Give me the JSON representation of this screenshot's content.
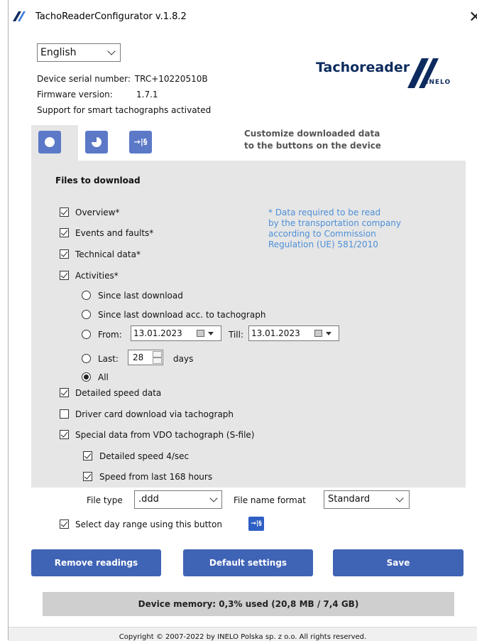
{
  "window": {
    "title": "TachoReaderConfigurator v.1.8.2",
    "close_glyph": "✕"
  },
  "language": {
    "selected": "English"
  },
  "device": {
    "serial_label": "Device serial number:",
    "serial_value": "TRC+10220510B",
    "firmware_label": "Firmware version:",
    "firmware_value": "1.7.1",
    "smart_support": "Support for smart tachographs activated"
  },
  "brand": {
    "name": "Tachoreader",
    "sub": "INELO"
  },
  "tabs": {
    "items": [
      {
        "icon": "circle-icon",
        "active": true
      },
      {
        "icon": "pie-chart-icon",
        "active": false
      },
      {
        "icon": "arrow-paragraph-icon",
        "label": "→|§",
        "active": false
      }
    ],
    "hint_line1": "Customize downloaded data",
    "hint_line2": "to the buttons on the device"
  },
  "files": {
    "title": "Files to download",
    "overview": {
      "label": "Overview*",
      "checked": true
    },
    "events": {
      "label": "Events and faults*",
      "checked": true
    },
    "technical": {
      "label": "Technical data*",
      "checked": true
    },
    "activities": {
      "label": "Activities*",
      "checked": true
    },
    "note": [
      "* Data required to be read",
      "by the transportation company",
      "according to Commission",
      "Regulation (UE) 581/2010"
    ],
    "activity_options": {
      "since_last": "Since last download",
      "since_last_tacho": "Since last download acc. to tachograph",
      "from_label": "From:",
      "from_value": "13.01.2023",
      "till_label": "Till:",
      "till_value": "13.01.2023",
      "last_label": "Last:",
      "last_value": "28",
      "days_label": "days",
      "all_label": "All",
      "selected": "all"
    },
    "detailed_speed": {
      "label": "Detailed speed data",
      "checked": true
    },
    "driver_card": {
      "label": "Driver card download via tachograph",
      "checked": false
    },
    "special_vdo": {
      "label": "Special data from VDO tachograph (S-file)",
      "checked": true
    },
    "detailed_speed_4": {
      "label": "Detailed speed 4/sec",
      "checked": true
    },
    "speed_168": {
      "label": "Speed from last 168 hours",
      "checked": true
    }
  },
  "file_type": {
    "label": "File type",
    "value": ".ddd"
  },
  "file_name_format": {
    "label": "File name format",
    "value": "Standard"
  },
  "day_range": {
    "label": "Select day range using this button",
    "checked": true,
    "icon_label": "→|§"
  },
  "buttons": {
    "remove": "Remove readings",
    "default": "Default settings",
    "save": "Save"
  },
  "memory": {
    "text": "Device memory: 0,3% used (20,8 MB / 7,4 GB)"
  },
  "footer": {
    "copyright": "Copyright © 2007-2022 by INELO Polska sp. z o.o. All rights reserved."
  },
  "colors": {
    "accent": "#3f63b5",
    "tab": "#5b79c7",
    "note": "#4d8fd6",
    "panel": "#e6e6e6",
    "brand": "#0d2b5e"
  }
}
